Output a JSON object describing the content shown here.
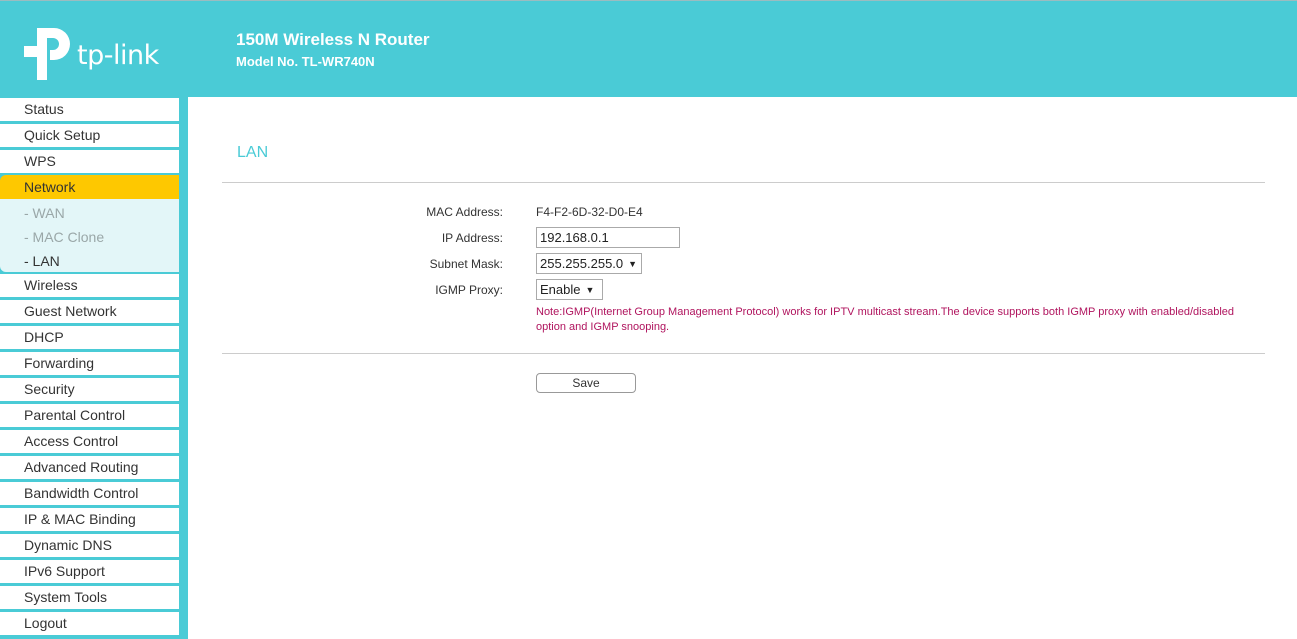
{
  "header": {
    "logo_text": "tp-link",
    "product_title": "150M Wireless N Router",
    "model": "Model No. TL-WR740N",
    "brand_color": "#4acbd6"
  },
  "sidebar": {
    "items": [
      {
        "label": "Status"
      },
      {
        "label": "Quick Setup"
      },
      {
        "label": "WPS"
      },
      {
        "label": "Network",
        "active": true
      },
      {
        "label": "Wireless"
      },
      {
        "label": "Guest Network"
      },
      {
        "label": "DHCP"
      },
      {
        "label": "Forwarding"
      },
      {
        "label": "Security"
      },
      {
        "label": "Parental Control"
      },
      {
        "label": "Access Control"
      },
      {
        "label": "Advanced Routing"
      },
      {
        "label": "Bandwidth Control"
      },
      {
        "label": "IP & MAC Binding"
      },
      {
        "label": "Dynamic DNS"
      },
      {
        "label": "IPv6 Support"
      },
      {
        "label": "System Tools"
      },
      {
        "label": "Logout"
      }
    ],
    "submenu": [
      {
        "label": "- WAN"
      },
      {
        "label": "- MAC Clone"
      },
      {
        "label": "- LAN",
        "current": true
      }
    ],
    "active_color": "#fec800"
  },
  "main": {
    "section_title": "LAN",
    "fields": {
      "mac_label": "MAC Address:",
      "mac_value": "F4-F2-6D-32-D0-E4",
      "ip_label": "IP Address:",
      "ip_value": "192.168.0.1",
      "subnet_label": "Subnet Mask:",
      "subnet_value": "255.255.255.0",
      "igmp_label": "IGMP Proxy:",
      "igmp_value": "Enable"
    },
    "note": "Note:IGMP(Internet Group Management Protocol) works for IPTV multicast stream.The device supports both IGMP proxy with enabled/disabled option and IGMP snooping.",
    "save_label": "Save",
    "note_color": "#b0145e"
  }
}
